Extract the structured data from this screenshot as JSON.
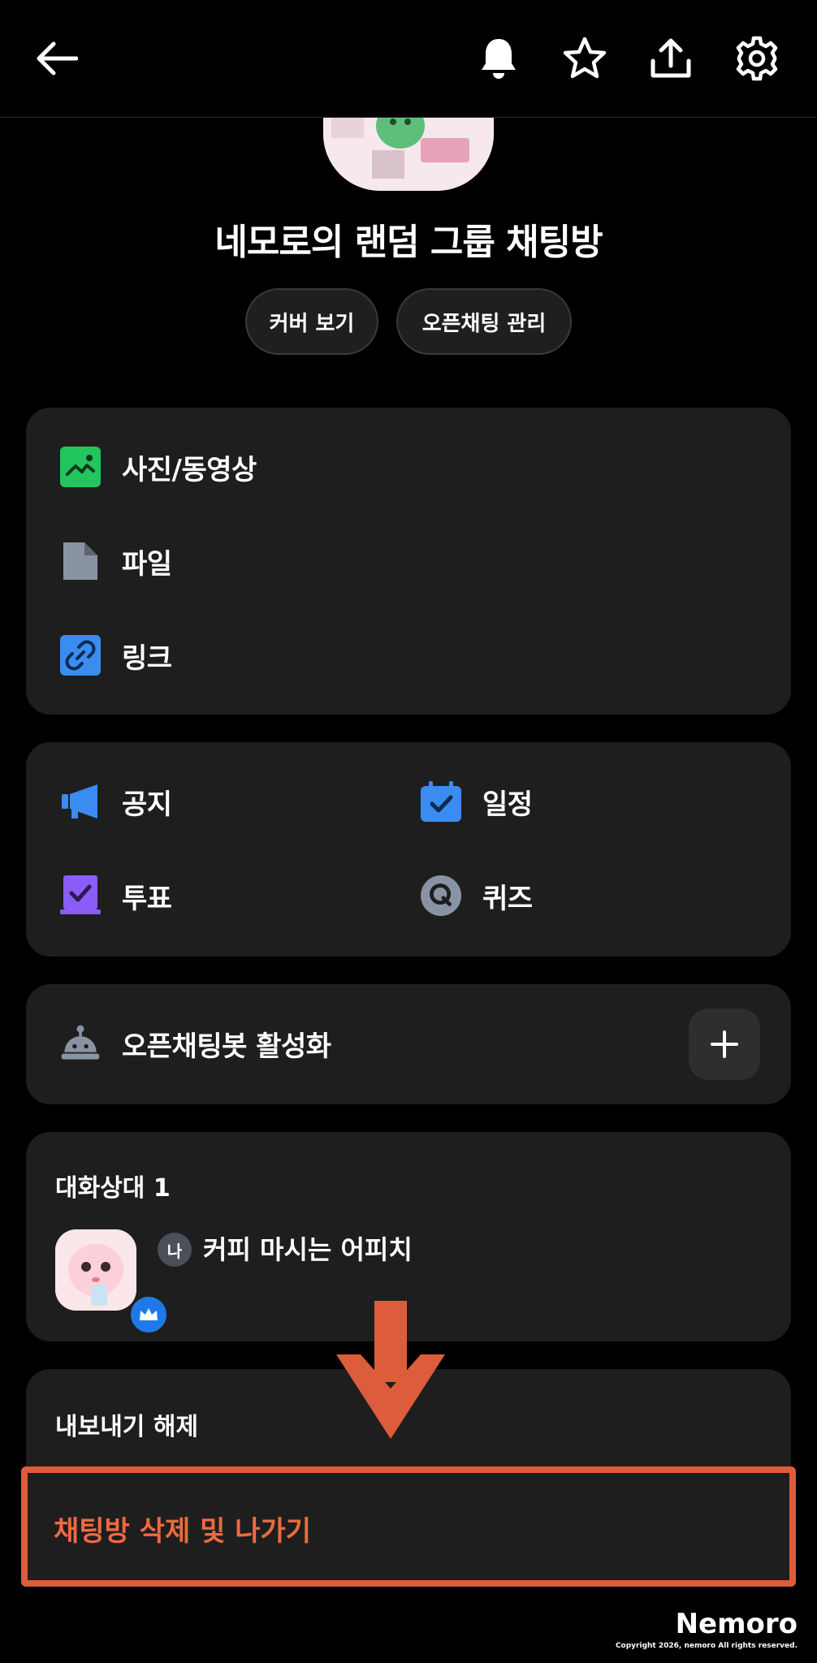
{
  "header": {
    "back_icon": "arrow-left-icon",
    "actions": [
      "bell-icon",
      "star-icon",
      "share-icon",
      "gear-icon"
    ]
  },
  "room": {
    "title": "네모로의 랜덤 그룹 채팅방",
    "buttons": {
      "cover": "커버 보기",
      "manage": "오픈채팅 관리"
    }
  },
  "media": {
    "photos": "사진/동영상",
    "files": "파일",
    "links": "링크"
  },
  "tools": {
    "notice": "공지",
    "schedule": "일정",
    "vote": "투표",
    "quiz": "퀴즈"
  },
  "bot": {
    "label": "오픈채팅봇 활성화"
  },
  "members": {
    "title": "대화상대 1",
    "me_badge": "나",
    "name": "커피 마시는 어피치"
  },
  "settings": {
    "export_release": "내보내기 해제",
    "delete_leave": "채팅방 삭제 및 나가기"
  },
  "colors": {
    "accent_green": "#22c55e",
    "accent_blue": "#3b8cf0",
    "accent_purple": "#8b5cf6",
    "danger": "#ee6a40",
    "highlight": "#dd5c3c"
  },
  "watermark": {
    "brand": "Nemoro",
    "copyright": "Copyright 2026, nemoro All rights reserved."
  }
}
